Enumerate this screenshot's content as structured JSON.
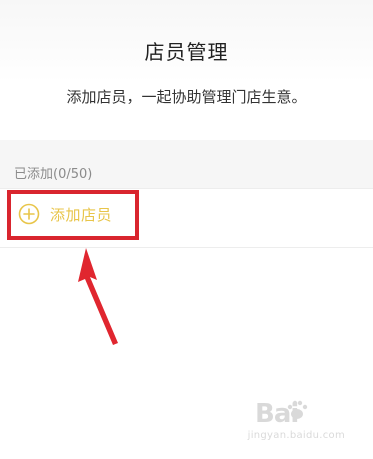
{
  "header": {
    "title": "店员管理",
    "subtitle": "添加店员，一起协助管理门店生意。"
  },
  "staff_section": {
    "added_count_label": "已添加(0/50)",
    "add_staff_label": "添加店员"
  },
  "colors": {
    "accent": "#E8C54A",
    "annotation_red": "#D9252E"
  },
  "icons": {
    "add": "plus-circle-icon"
  },
  "watermark": {
    "logo_text": "Bai",
    "site_text": "jingyan.baidu.com"
  }
}
